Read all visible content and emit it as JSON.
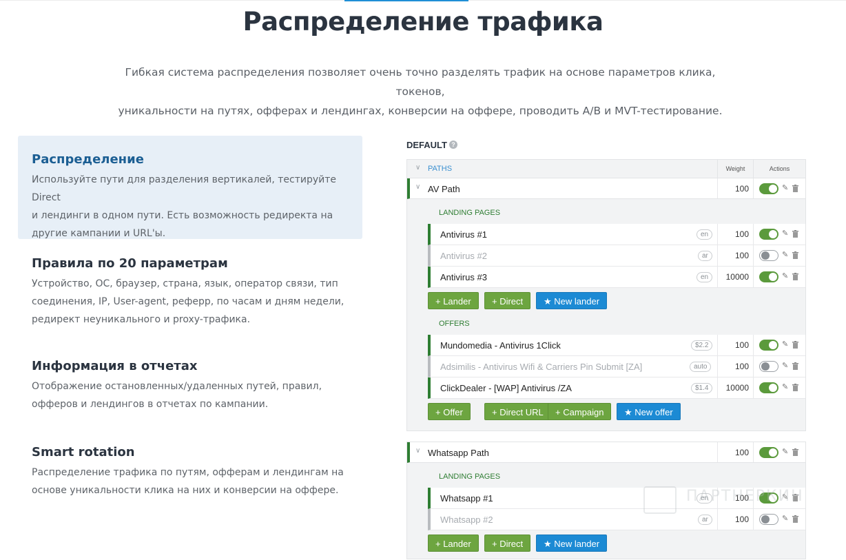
{
  "page": {
    "title": "Распределение трафика",
    "intro_line1": "Гибкая система распределения позволяет очень точно разделять трафик на основе параметров клика, токенов,",
    "intro_line2": "уникальности на путях, офферах и лендингах, конверсии на оффере, проводить A/B и MVT-тестирование."
  },
  "features": [
    {
      "title": "Распределение",
      "line1": "Используйте пути для разделения вертикалей, тестируйте Direct",
      "line2": "и лендинги в одном пути. Есть возможность редиректа на",
      "line3": "другие кампании и URL'ы."
    },
    {
      "title": "Правила по 20 параметрам",
      "line1": "Устройство, ОС, браузер, страна, язык, оператор связи, тип",
      "line2": "соединения, IP, User-agent, реферр, по часам и дням недели,",
      "line3": "редирект неуникального и proxy-трафика."
    },
    {
      "title": "Информация в отчетах",
      "line1": "Отображение остановленных/удаленных путей, правил,",
      "line2": "офферов и лендингов в отчетах по кампании."
    },
    {
      "title": "Smart rotation",
      "line1": "Распределение трафика по путям, офферам и лендингам на",
      "line2": "основе уникальности клика на них и конверсии на оффере."
    }
  ],
  "panel": {
    "default_label": "DEFAULT",
    "help_icon": "?",
    "paths_label": "PATHS",
    "weight_label": "Weight",
    "actions_label": "Actions",
    "landing_label": "LANDING PAGES",
    "offers_label": "OFFERS",
    "paths": [
      {
        "name": "AV Path",
        "weight": "100",
        "enabled": true,
        "landers": [
          {
            "name": "Antivirus #1",
            "tag": "en",
            "weight": "100",
            "enabled": true
          },
          {
            "name": "Antivirus #2",
            "tag": "ar",
            "weight": "100",
            "enabled": false
          },
          {
            "name": "Antivirus #3",
            "tag": "en",
            "weight": "10000",
            "enabled": true
          }
        ],
        "lander_buttons": [
          "+ Lander",
          "+ Direct",
          "★ New lander"
        ],
        "offers": [
          {
            "name": "Mundomedia - Antivirus 1Click",
            "tag": "$2.2",
            "weight": "100",
            "enabled": true
          },
          {
            "name": "Adsimilis - Antivirus Wifi & Carriers Pin Submit [ZA]",
            "tag": "auto",
            "weight": "100",
            "enabled": false
          },
          {
            "name": "ClickDealer - [WAP] Antivirus /ZA",
            "tag": "$1.4",
            "weight": "10000",
            "enabled": true
          }
        ],
        "offer_buttons": [
          "+ Offer",
          "+ Direct URL",
          "+ Campaign",
          "★ New offer"
        ]
      },
      {
        "name": "Whatsapp Path",
        "weight": "100",
        "enabled": true,
        "landers": [
          {
            "name": "Whatsapp #1",
            "tag": "en",
            "weight": "100",
            "enabled": true
          },
          {
            "name": "Whatsapp #2",
            "tag": "ar",
            "weight": "100",
            "enabled": false
          }
        ],
        "lander_buttons": [
          "+ Lander",
          "+ Direct",
          "★ New lander"
        ]
      }
    ]
  },
  "watermark": "ПАРТНЕРКИН",
  "colors": {
    "accent_green": "#6da540",
    "accent_blue": "#1c8ad4",
    "path_bar": "#2e7d32",
    "active_feature_bg": "#e7eff7"
  },
  "icons": [
    "chevron-down-icon",
    "pencil-icon",
    "trash-icon",
    "help-icon",
    "star-icon",
    "plus-icon"
  ]
}
